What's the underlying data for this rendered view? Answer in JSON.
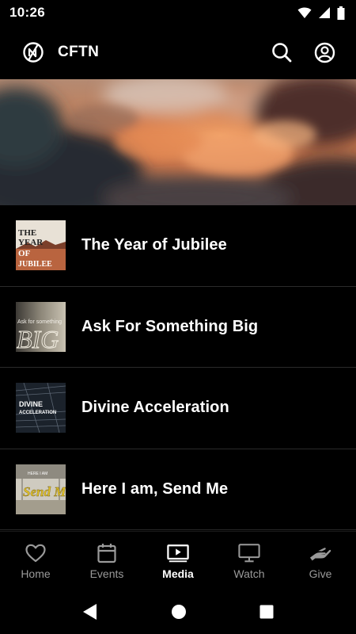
{
  "status_bar": {
    "time": "10:26"
  },
  "header": {
    "title": "CFTN"
  },
  "media_items": [
    {
      "title": "The Year of Jubilee",
      "thumb_icon": "jubilee-artwork"
    },
    {
      "title": "Ask For Something Big",
      "thumb_icon": "big-artwork"
    },
    {
      "title": "Divine Acceleration",
      "thumb_icon": "divine-acceleration-artwork"
    },
    {
      "title": "Here I am, Send Me",
      "thumb_icon": "send-me-artwork"
    }
  ],
  "thumb_text": {
    "jubilee": [
      "THE",
      "YEAR",
      "OF",
      "JUBILEE"
    ],
    "big": {
      "small": "Ask for something",
      "large": "BIG"
    },
    "divine": [
      "DIVINE",
      "ACCELERATION"
    ],
    "sendme": {
      "small": "HERE I AM",
      "large": "Send Me"
    }
  },
  "bottom_nav": [
    {
      "label": "Home",
      "icon": "heart-icon"
    },
    {
      "label": "Events",
      "icon": "calendar-icon"
    },
    {
      "label": "Media",
      "icon": "play-screen-icon",
      "active": true
    },
    {
      "label": "Watch",
      "icon": "monitor-icon"
    },
    {
      "label": "Give",
      "icon": "hand-icon"
    }
  ],
  "colors": {
    "background": "#000000",
    "active": "#ffffff",
    "inactive": "#9a9a9a"
  }
}
